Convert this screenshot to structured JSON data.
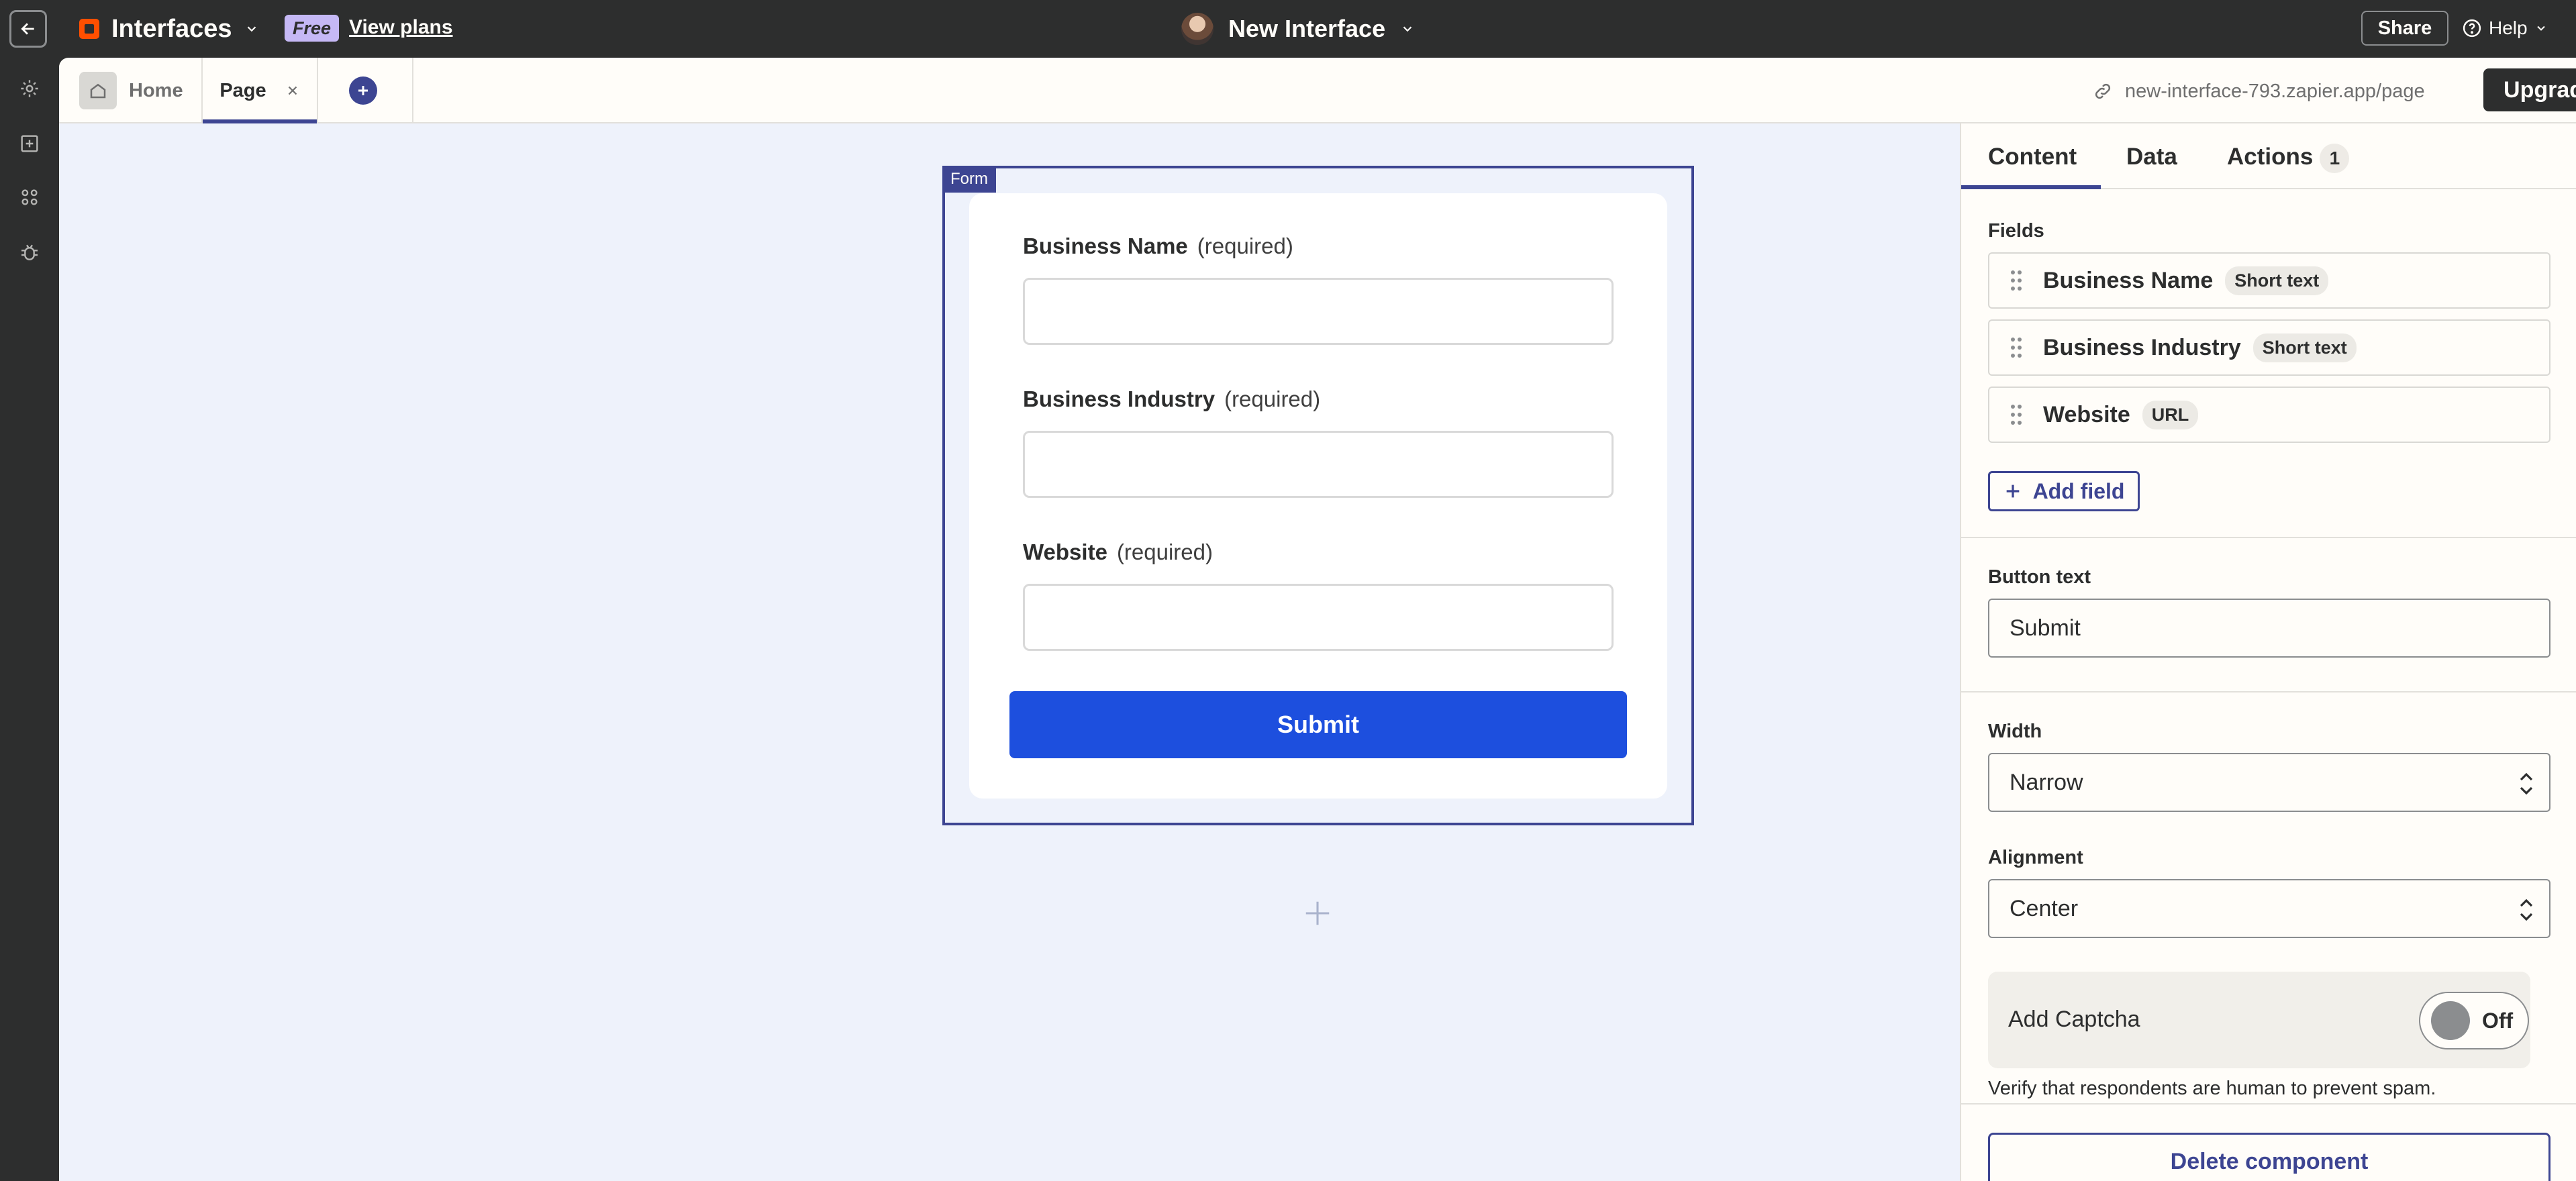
{
  "topbar": {
    "app_name": "Interfaces",
    "plan_badge": "Free",
    "view_plans": "View plans",
    "interface_name": "New Interface",
    "share": "Share",
    "help": "Help"
  },
  "rail": {
    "icons": [
      "gear-icon",
      "add-component-icon",
      "apps-icon",
      "bug-icon"
    ]
  },
  "tabs": {
    "home": "Home",
    "page": "Page",
    "url": "new-interface-793.zapier.app/page",
    "upgrade": "Upgrade"
  },
  "canvas": {
    "form_tag": "Form",
    "fields": [
      {
        "label": "Business Name",
        "required": "(required)",
        "value": ""
      },
      {
        "label": "Business Industry",
        "required": "(required)",
        "value": ""
      },
      {
        "label": "Website",
        "required": "(required)",
        "value": ""
      }
    ],
    "submit": "Submit"
  },
  "panel": {
    "tabs": {
      "content": "Content",
      "data": "Data",
      "actions": "Actions",
      "actions_count": "1"
    },
    "fields_label": "Fields",
    "fields": [
      {
        "name": "Business Name",
        "type": "Short text"
      },
      {
        "name": "Business Industry",
        "type": "Short text"
      },
      {
        "name": "Website",
        "type": "URL"
      }
    ],
    "add_field": "Add field",
    "button_text_label": "Button text",
    "button_text_value": "Submit",
    "width_label": "Width",
    "width_value": "Narrow",
    "alignment_label": "Alignment",
    "alignment_value": "Center",
    "captcha_label": "Add Captcha",
    "captcha_state": "Off",
    "captcha_help": "Verify that respondents are human to prevent spam.",
    "delete": "Delete component"
  },
  "colors": {
    "accent": "#3d4592",
    "submit_blue": "#1d4fde",
    "brand_orange": "#ff4f00",
    "topbar": "#2d2e2e",
    "canvas_bg": "#eef2fb"
  }
}
